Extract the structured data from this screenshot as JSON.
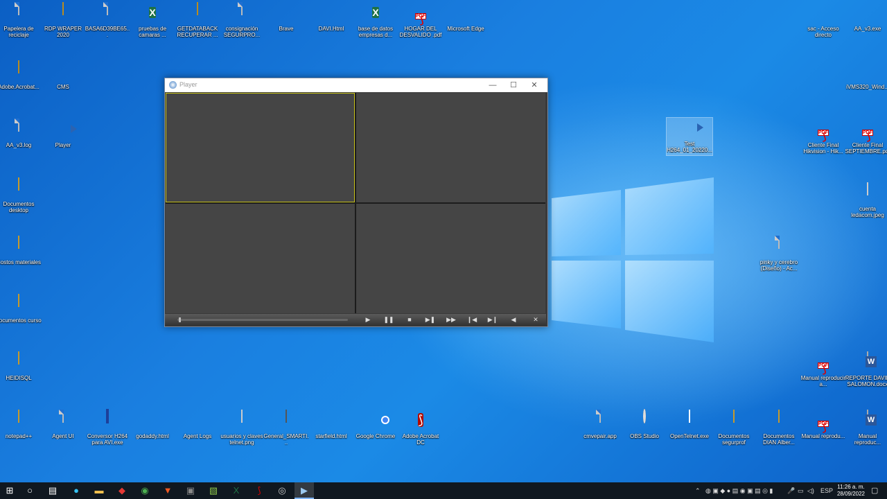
{
  "desktop_icons": {
    "recycle": "Papelera de reciclaje",
    "rdp": "RDP WRAPER 2020",
    "basa": "BASA6D39BE65...",
    "pruebas": "pruebas de camaras ...",
    "getdata": "GETDATABACK RECUPERAR ...",
    "consign": "consignación SEGURPRO...",
    "brave": "Brave",
    "davi": "DAVI.Html",
    "base": "base de datos empresas d...",
    "hogar": "HOGAR DEL DESVALIDO .pdf",
    "edge": "Microsoft Edge",
    "sac": "sac - Acceso directo",
    "aav3": "AA_v3.exe",
    "adobe_acrobat": "Adobe.Acrobat...",
    "cms": "CMS",
    "ivms": "iVMS320_Wind...",
    "aa_log": "AA_v3.log",
    "player": "Player",
    "test": "Test H264_01_20220...",
    "cliente1": "Cliente Final Hikvision - Hik...",
    "cliente2": "Cliente Final SEPTIEMBRE.pdf",
    "docs_desktop": "Documentos desktop",
    "cuenta": "cuenta ledacom.jpeg",
    "costos": "Costos materiales",
    "pinky": "pinky y cerebro (Diseño) - Ac...",
    "docs_curso": "documentos curso",
    "heidisql": "HEIDISQL",
    "manual1": "Manual reproducir a...",
    "reporte": "REPORTE DAVID SALOMON.docx",
    "notepad": "notepad++",
    "agent_ui": "Agent UI",
    "conversor": "Conversor H264 para AVI.exe",
    "godaddy": "godaddy.html",
    "agent_logs": "Agent Logs",
    "usuarios": "usuarios y claves telnet.png",
    "general_smart": "General_SMARTI...",
    "starfield": "starfield.html",
    "chrome": "Google Chrome",
    "acrobat_dc": "Adobe Acrobat DC",
    "cmvepair": "cmvepair.app",
    "obs": "OBS Studio",
    "opentelnet": "OpenTelnet.exe",
    "docs_segur": "Documentos segurprof",
    "docs_dian": "Documentos DIAN Alber...",
    "manual2": "Manual reprodu...",
    "manual3": "Manual reproduc..."
  },
  "player": {
    "title": "Player",
    "minimize": "—",
    "maximize": "☐",
    "close": "✕"
  },
  "taskbar": {
    "language": "ESP",
    "time": "11:26 a. m.",
    "date": "28/09/2022"
  },
  "colors": {
    "desktop": "#1a7fe0",
    "active_cell_border": "#c8c21a",
    "taskbar": "#101820"
  }
}
